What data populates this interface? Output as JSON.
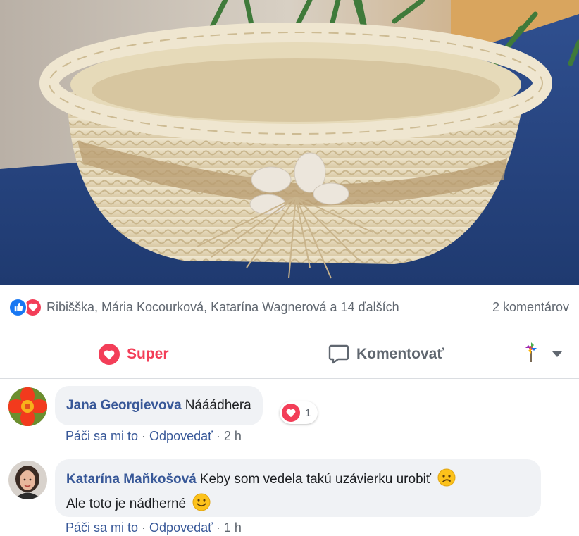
{
  "post": {
    "photo_icon": "woven-basket-photo",
    "reactions": {
      "icons": [
        "like-icon",
        "love-icon"
      ],
      "names": "Ribišška, Mária Kocourková, Katarína Wagnerová a 14 ďalších",
      "comment_count": "2 komentárov"
    },
    "actions": {
      "super_label": "Super",
      "comment_label": "Komentovať"
    }
  },
  "comments": [
    {
      "author": "Jana Georgievova",
      "text": "Nááádhera",
      "reaction_count": "1",
      "like_label": "Páči sa mi to",
      "separator": "·",
      "reply_label": "Odpovedať",
      "time": "2 h"
    },
    {
      "author": "Katarína Maňkošová",
      "text_line1": "Keby som vedela takú uzávierku urobiť",
      "text_line2": "Ale toto je nádherné",
      "like_label": "Páči sa mi to",
      "separator": "·",
      "reply_label": "Odpovedať",
      "time": "1 h"
    }
  ],
  "colors": {
    "accent_blue": "#1877f2",
    "love_red": "#f33e58",
    "author_blue": "#385898",
    "muted": "#606770"
  }
}
